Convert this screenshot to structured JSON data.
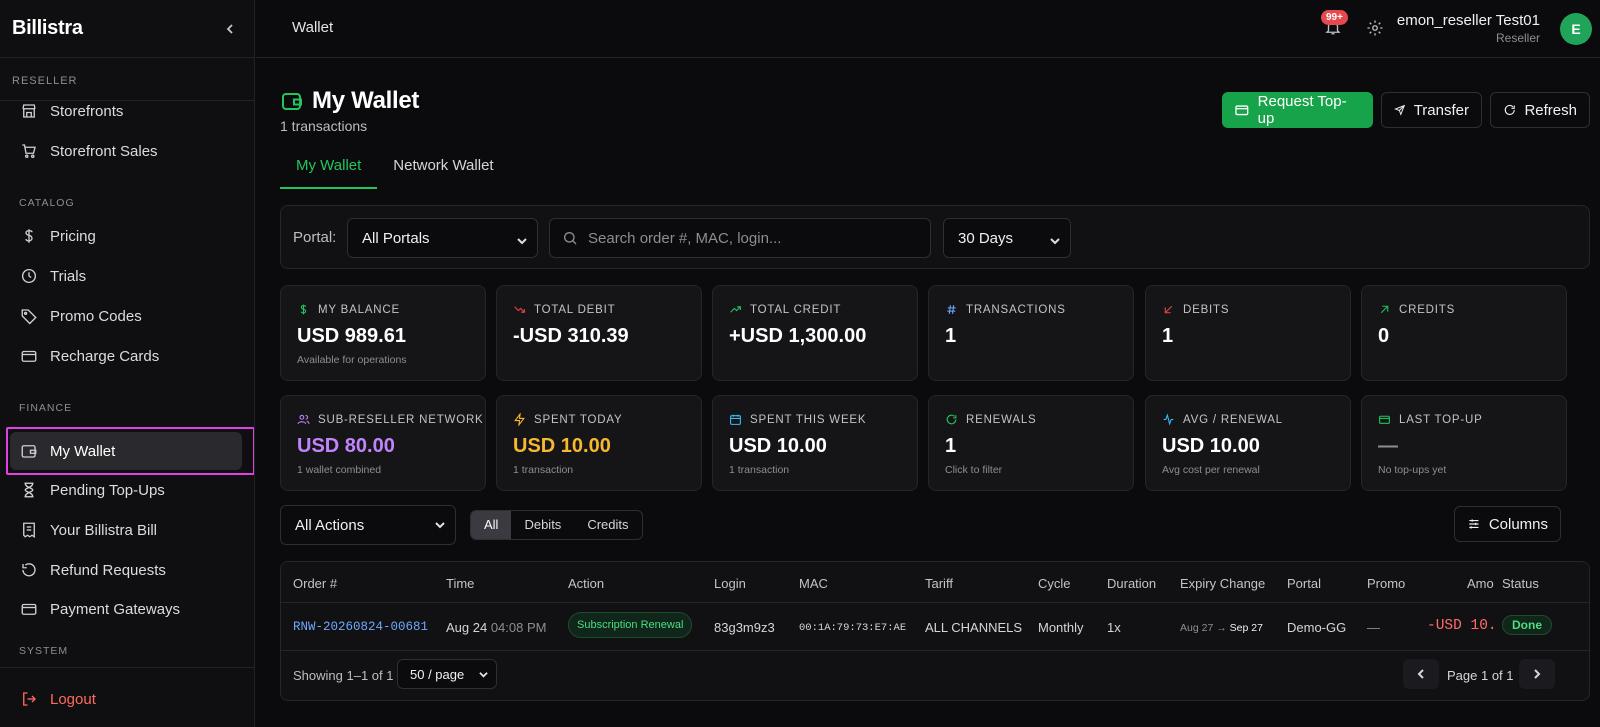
{
  "brand": "Billistra",
  "sidebar": {
    "sections": {
      "reseller": "RESELLER",
      "catalog": "CATALOG",
      "finance": "FINANCE",
      "system": "SYSTEM"
    },
    "items": [
      {
        "label": "Storefronts",
        "icon": "store-icon"
      },
      {
        "label": "Storefront Sales",
        "icon": "cart-icon"
      },
      {
        "label": "Pricing",
        "icon": "dollar-icon"
      },
      {
        "label": "Trials",
        "icon": "clock-icon"
      },
      {
        "label": "Promo Codes",
        "icon": "tag-icon"
      },
      {
        "label": "Recharge Cards",
        "icon": "card-icon"
      },
      {
        "label": "My Wallet",
        "icon": "wallet-icon",
        "active": true
      },
      {
        "label": "Pending Top-Ups",
        "icon": "hourglass-icon"
      },
      {
        "label": "Your Billistra Bill",
        "icon": "receipt-icon"
      },
      {
        "label": "Refund Requests",
        "icon": "refund-icon"
      },
      {
        "label": "Payment Gateways",
        "icon": "card-icon"
      }
    ],
    "logout": "Logout"
  },
  "topbar": {
    "breadcrumb": "Wallet",
    "notif_count": "99+",
    "user_name": "emon_reseller Test01",
    "user_role": "Reseller",
    "avatar_letter": "E"
  },
  "page": {
    "title": "My Wallet",
    "subtitle": "1 transactions",
    "buttons": {
      "request": "Request Top-up",
      "transfer": "Transfer",
      "refresh": "Refresh"
    },
    "tabs": [
      "My Wallet",
      "Network Wallet"
    ]
  },
  "filters": {
    "portal_label": "Portal:",
    "portal_value": "All Portals",
    "search_placeholder": "Search order #, MAC, login...",
    "range_value": "30 Days"
  },
  "stats": [
    {
      "label": "MY BALANCE",
      "value": "USD 989.61",
      "sub": "Available for operations",
      "icon": "dollar-icon",
      "icon_color": "#22c55e",
      "value_color": "#ffffff"
    },
    {
      "label": "TOTAL DEBIT",
      "value": "-USD 310.39",
      "sub": "",
      "icon": "trend-down-icon",
      "icon_color": "#ef4444",
      "value_color": "#ffffff"
    },
    {
      "label": "TOTAL CREDIT",
      "value": "+USD 1,300.00",
      "sub": "",
      "icon": "trend-up-icon",
      "icon_color": "#22c55e",
      "value_color": "#ffffff"
    },
    {
      "label": "TRANSACTIONS",
      "value": "1",
      "sub": "",
      "icon": "hash-icon",
      "icon_color": "#6ea8ff",
      "value_color": "#ffffff"
    },
    {
      "label": "DEBITS",
      "value": "1",
      "sub": "",
      "icon": "arrow-down-left-icon",
      "icon_color": "#ef4444",
      "value_color": "#ffffff"
    },
    {
      "label": "CREDITS",
      "value": "0",
      "sub": "",
      "icon": "arrow-up-right-icon",
      "icon_color": "#22c55e",
      "value_color": "#ffffff"
    },
    {
      "label": "SUB-RESELLER NETWORK",
      "value": "USD 80.00",
      "sub": "1 wallet combined",
      "icon": "users-icon",
      "icon_color": "#c084fc",
      "value_color": "#c084fc"
    },
    {
      "label": "SPENT TODAY",
      "value": "USD 10.00",
      "sub": "1 transaction",
      "icon": "bolt-icon",
      "icon_color": "#f5b82e",
      "value_color": "#f5b82e"
    },
    {
      "label": "SPENT THIS WEEK",
      "value": "USD 10.00",
      "sub": "1 transaction",
      "icon": "calendar-icon",
      "icon_color": "#38bdf8",
      "value_color": "#ffffff"
    },
    {
      "label": "RENEWALS",
      "value": "1",
      "sub": "Click to filter",
      "icon": "refresh-icon",
      "icon_color": "#22c55e",
      "value_color": "#ffffff"
    },
    {
      "label": "AVG / RENEWAL",
      "value": "USD 10.00",
      "sub": "Avg cost per renewal",
      "icon": "activity-icon",
      "icon_color": "#38bdf8",
      "value_color": "#ffffff"
    },
    {
      "label": "LAST TOP-UP",
      "value": "—",
      "sub": "No top-ups yet",
      "icon": "card-icon",
      "icon_color": "#22c55e",
      "value_color": "#8d8d93"
    }
  ],
  "actions_filter": "All Actions",
  "segments": [
    "All",
    "Debits",
    "Credits"
  ],
  "columns_button": "Columns",
  "table": {
    "headers": [
      "Order #",
      "Time",
      "Action",
      "Login",
      "MAC",
      "Tariff",
      "Cycle",
      "Duration",
      "Expiry Change",
      "Portal",
      "Promo",
      "Amo",
      "Status"
    ],
    "rows": [
      {
        "order": "RNW-20260824-00681",
        "date": "Aug 24",
        "time": "04:08 PM",
        "action": "Subscription Renewal",
        "login": "83g3m9z3",
        "mac": "00:1A:79:73:E7:AE",
        "tariff": "ALL CHANNELS",
        "cycle": "Monthly",
        "duration": "1x",
        "expiry_from": "Aug 27",
        "expiry_arrow": "→",
        "expiry_to": "Sep 27",
        "portal": "Demo-GG",
        "promo": "—",
        "amount": "-USD 10.",
        "status": "Done"
      }
    ]
  },
  "pagination": {
    "showing": "Showing 1–1 of 1",
    "per_page": "50 / page",
    "page_text": "Page 1 of 1"
  }
}
